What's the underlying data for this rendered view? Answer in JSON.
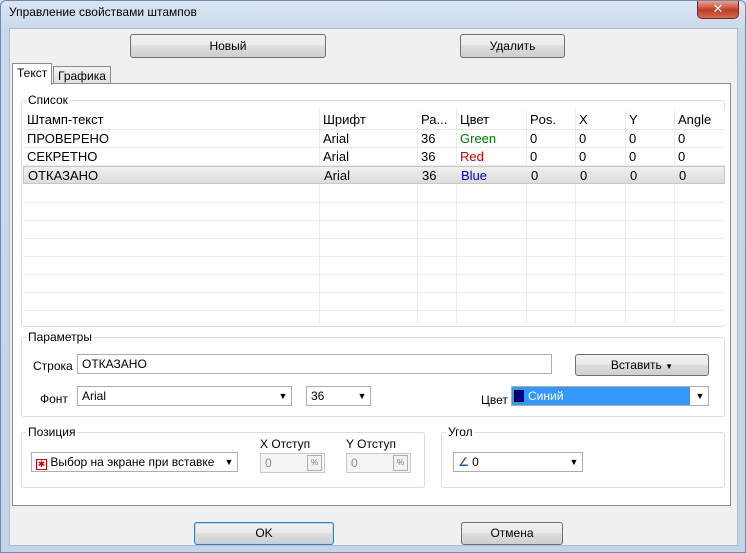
{
  "window": {
    "title": "Управление свойствами штампов",
    "close_glyph": "✕"
  },
  "toolbar": {
    "new_label": "Новый",
    "delete_label": "Удалить"
  },
  "tabs": [
    {
      "label": "Текст"
    },
    {
      "label": "Графика"
    }
  ],
  "list": {
    "group_label": "Список",
    "columns": [
      "Штамп-текст",
      "Шрифт",
      "Ра...",
      "Цвет",
      "Pos.",
      "X",
      "Y",
      "Angle"
    ],
    "rows": [
      {
        "text": "ПРОВЕРЕНО",
        "font": "Arial",
        "size": "36",
        "color": "Green",
        "color_hex": "#007a00",
        "pos": "0",
        "x": "0",
        "y": "0",
        "angle": "0"
      },
      {
        "text": "СЕКРЕТНО",
        "font": "Arial",
        "size": "36",
        "color": "Red",
        "color_hex": "#cc0000",
        "pos": "0",
        "x": "0",
        "y": "0",
        "angle": "0"
      },
      {
        "text": "ОТКАЗАНО",
        "font": "Arial",
        "size": "36",
        "color": "Blue",
        "color_hex": "#0000cc",
        "pos": "0",
        "x": "0",
        "y": "0",
        "angle": "0"
      }
    ]
  },
  "params": {
    "group_label": "Параметры",
    "string_label": "Строка",
    "string_value": "ОТКАЗАНО",
    "insert_label": "Вставить",
    "font_label": "Фонт",
    "font_value": "Arial",
    "size_value": "36",
    "color_label": "Цвет",
    "color_value": "Синий"
  },
  "position": {
    "group_label": "Позиция",
    "mode_value": "Выбор на экране при вставке",
    "x_label": "X Отступ",
    "x_value": "0",
    "y_label": "Y Отступ",
    "y_value": "0"
  },
  "angle": {
    "group_label": "Угол",
    "value": "0"
  },
  "footer": {
    "ok_label": "OK",
    "cancel_label": "Отмена"
  },
  "icons": {
    "dropdown": "chevron-down-icon",
    "position_mode": "crosshair-icon",
    "angle": "angle-icon",
    "percent": "percent-icon"
  },
  "colors": {
    "accent": "#3399ff",
    "selected_color": "#00008b"
  }
}
